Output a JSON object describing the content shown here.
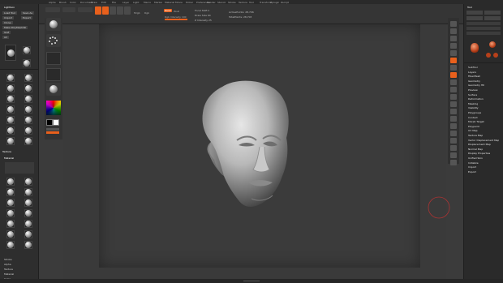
{
  "colors": {
    "accent": "#e8601c",
    "bg": "#3b3b3b"
  },
  "menubar": {
    "items": [
      "Alpha",
      "Brush",
      "Color",
      "Document",
      "Draw",
      "Edit",
      "File",
      "Layer",
      "Light",
      "Macro",
      "Marker",
      "Material",
      "Movie",
      "Picker",
      "Preferences",
      "Render",
      "Stencil",
      "Stroke",
      "Texture",
      "Tool",
      "Transform",
      "Zplugin",
      "Zscript"
    ]
  },
  "toolbar": {
    "brush": "Standard",
    "rgb_label": "Rgb",
    "zadd": "Zadd",
    "zsub": "Zsub",
    "focal_shift": "Focal Shift 0",
    "draw_size": "Draw Size 64",
    "z_intensity": "Z Intensity 25",
    "active_points": "ActivePoints: 28,706",
    "total_points": "TotalPoints: 28,706",
    "mrgb": "Mrgb",
    "rgb_intensity": "Rgb Intensity 100"
  },
  "left_panel": {
    "title": "Lightbox",
    "load_tool": "Load Tool",
    "save_as": "Save As",
    "import": "Import",
    "export": "Export",
    "clone": "Clone",
    "make_polymesh": "Make PolyMesh3D",
    "goz": "GoZ",
    "all": "All",
    "visible": "Visible",
    "brush_section": "Texture",
    "material_section": "Material",
    "bottom_items": [
      "Stroke",
      "Alpha",
      "Texture",
      "Material",
      "Color"
    ]
  },
  "right_panel": {
    "title": "Tool",
    "menu_items": [
      "SubTool",
      "Layers",
      "FiberMesh",
      "Geometry",
      "Geometry HD",
      "Preview",
      "Surface",
      "Deformation",
      "Masking",
      "Visibility",
      "Polygroups",
      "Contact",
      "Morph Target",
      "Polypaint",
      "UV Map",
      "Texture Map",
      "Vector Displacement Map",
      "Displacement Map",
      "Normal Map",
      "Display Properties",
      "Unified Skin",
      "Initialize",
      "Import",
      "Export"
    ]
  },
  "status": {
    "text": ""
  }
}
